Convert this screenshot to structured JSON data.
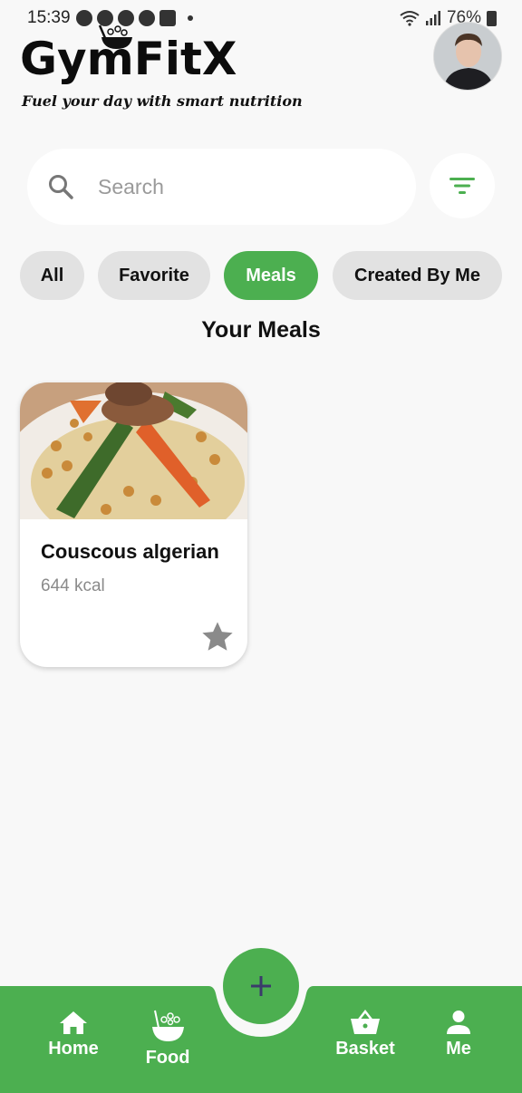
{
  "status_bar": {
    "time": "15:39",
    "battery": "76%",
    "notification_icons": [
      "snapchat-icon",
      "snapchat-icon",
      "chat-icon",
      "messenger-icon",
      "gmail-icon"
    ]
  },
  "header": {
    "logo_text": "GymFitX",
    "tagline": "Fuel your day with smart nutrition"
  },
  "search": {
    "placeholder": "Search"
  },
  "filters": {
    "chips": [
      {
        "label": "All",
        "active": false
      },
      {
        "label": "Favorite",
        "active": false
      },
      {
        "label": "Meals",
        "active": true
      },
      {
        "label": "Created By Me",
        "active": false
      }
    ]
  },
  "section": {
    "title": "Your Meals"
  },
  "meals": [
    {
      "name": "Couscous algerian",
      "kcal": "644 kcal",
      "favorite": false
    }
  ],
  "bottom_nav": {
    "items": [
      {
        "label": "Home",
        "icon": "home-icon"
      },
      {
        "label": "Food",
        "icon": "food-bowl-icon"
      },
      {
        "label": "Basket",
        "icon": "basket-icon"
      },
      {
        "label": "Me",
        "icon": "person-icon"
      }
    ],
    "fab_icon": "plus-icon"
  },
  "colors": {
    "accent": "#4caf50",
    "background": "#f8f8f8",
    "chip_inactive": "#e2e2e2",
    "fab_plus": "#3b3b6b"
  }
}
